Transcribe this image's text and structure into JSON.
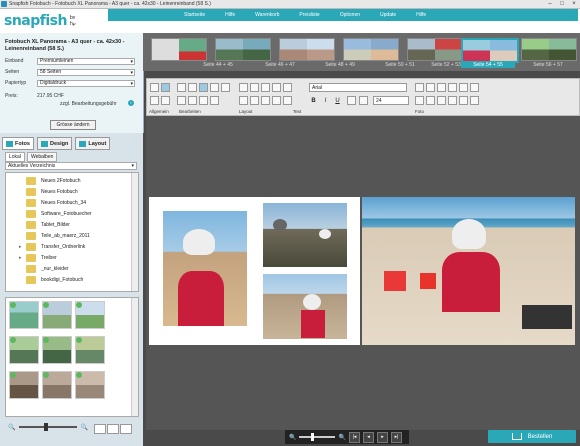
{
  "window": {
    "title": "Snapfish Fotobuch - Fotobuch XL Panorama - A3 quer - ca. 42x30 - Leinenreinband (58 S.)",
    "buttons": [
      "–",
      "□",
      "×"
    ]
  },
  "header": {
    "logo_text": "snapfish",
    "logo_sub": "by hp",
    "nav": [
      "Startseite",
      "Hilfe",
      "Warenkorb",
      "Preisliste",
      "Optionen",
      "Update",
      "Hilfe"
    ]
  },
  "props": {
    "title": "Fotobuch XL Panorama - A3 quer - ca. 42x30 - Leinenreinband (58 S.)",
    "rows": [
      {
        "label": "Einband",
        "value": "Premiumleinen"
      },
      {
        "label": "Seiten",
        "value": "58 Seiten"
      },
      {
        "label": "Papiertyp",
        "value": "Digitaldruck"
      }
    ],
    "price_label": "Preis:",
    "price_value": "217.95 CHF",
    "fee_text": "zzgl. Bearbeitungsgebühr",
    "size_button": "Grösse ändern"
  },
  "tabs": [
    "Fotos",
    "Design",
    "Layout"
  ],
  "subtabs": [
    "Lokal",
    "Webalben"
  ],
  "directory": "Aktuelles Verzeichnis",
  "folders": [
    "Neues 2Fotobuch",
    "Neues Fotobuch",
    "Neues Fotobuch_34",
    "Software_Fotobuecher",
    "Tablet_Bilder",
    "Teile_ab_maerz_2011",
    "Transfer_Ordnerlink",
    "Treiber",
    "_nur_kleider",
    "bookdigi_Fotobuch"
  ],
  "strip": {
    "pages": [
      "Seite 44 + 45",
      "Seite 46 + 47",
      "Seite 48 + 49",
      "Seite 50 + 51",
      "Seite 52 + 53",
      "Seite 54 + 55",
      "Seite 56 + 57"
    ],
    "selected_index": 5
  },
  "toolbar": {
    "groups": [
      "Allgemein",
      "Bearbeiten",
      "Layout",
      "Text",
      "Foto"
    ],
    "font": "Arial",
    "font_size": "24",
    "format": [
      "B",
      "I",
      "U"
    ]
  },
  "bottom": {
    "order_button": "Bestellen"
  },
  "colors": {
    "accent": "#2aa8b8",
    "panel": "#eaf3f6",
    "canvas": "#555555"
  }
}
